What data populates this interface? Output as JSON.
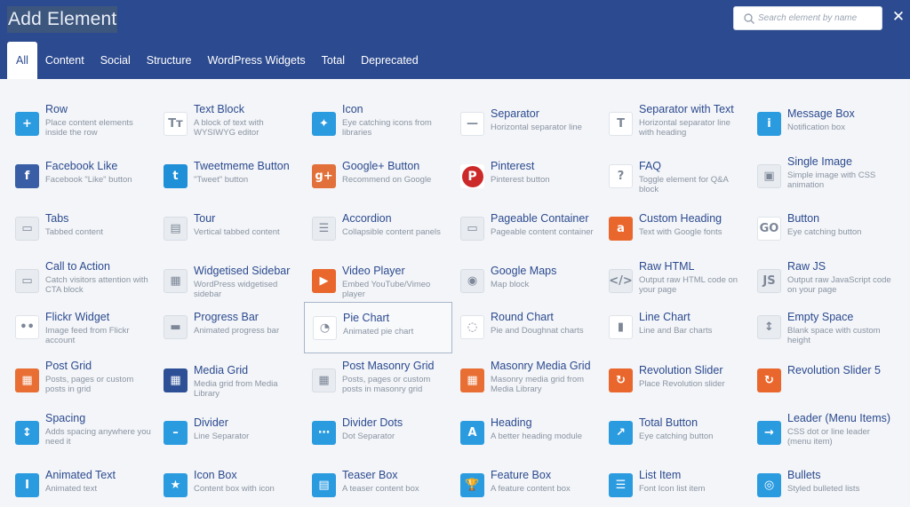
{
  "header": {
    "title": "Add Element",
    "search_placeholder": "Search element by name",
    "close_symbol": "✕"
  },
  "tabs": [
    "All",
    "Content",
    "Social",
    "Structure",
    "WordPress Widgets",
    "Total",
    "Deprecated"
  ],
  "colors": {
    "header": "#2c4a8f",
    "accent_blue": "#2b9be0",
    "accent_orange": "#e9672d"
  },
  "elements": [
    {
      "name": "Row",
      "desc": "Place content elements inside the row",
      "icon": "plus-icon"
    },
    {
      "name": "Text Block",
      "desc": "A block of text with WYSIWYG editor",
      "icon": "text-icon"
    },
    {
      "name": "Icon",
      "desc": "Eye catching icons from libraries",
      "icon": "star-icon"
    },
    {
      "name": "Separator",
      "desc": "Horizontal separator line",
      "icon": "separator-icon"
    },
    {
      "name": "Separator with Text",
      "desc": "Horizontal separator line with heading",
      "icon": "separator-text-icon"
    },
    {
      "name": "Message Box",
      "desc": "Notification box",
      "icon": "info-icon"
    },
    {
      "name": "Facebook Like",
      "desc": "Facebook \"Like\" button",
      "icon": "facebook-icon"
    },
    {
      "name": "Tweetmeme Button",
      "desc": "\"Tweet\" button",
      "icon": "twitter-icon"
    },
    {
      "name": "Google+ Button",
      "desc": "Recommend on Google",
      "icon": "googleplus-icon"
    },
    {
      "name": "Pinterest",
      "desc": "Pinterest button",
      "icon": "pinterest-icon"
    },
    {
      "name": "FAQ",
      "desc": "Toggle element for Q&A block",
      "icon": "faq-icon"
    },
    {
      "name": "Single Image",
      "desc": "Simple image with CSS animation",
      "icon": "image-icon"
    },
    {
      "name": "Tabs",
      "desc": "Tabbed content",
      "icon": "tabs-icon"
    },
    {
      "name": "Tour",
      "desc": "Vertical tabbed content",
      "icon": "tour-icon"
    },
    {
      "name": "Accordion",
      "desc": "Collapsible content panels",
      "icon": "accordion-icon"
    },
    {
      "name": "Pageable Container",
      "desc": "Pageable content container",
      "icon": "pageable-icon"
    },
    {
      "name": "Custom Heading",
      "desc": "Text with Google fonts",
      "icon": "custom-heading-icon"
    },
    {
      "name": "Button",
      "desc": "Eye catching button",
      "icon": "button-icon"
    },
    {
      "name": "Call to Action",
      "desc": "Catch visitors attention with CTA block",
      "icon": "cta-icon"
    },
    {
      "name": "Widgetised Sidebar",
      "desc": "WordPress widgetised sidebar",
      "icon": "sidebar-icon"
    },
    {
      "name": "Video Player",
      "desc": "Embed YouTube/Vimeo player",
      "icon": "video-icon"
    },
    {
      "name": "Google Maps",
      "desc": "Map block",
      "icon": "map-icon"
    },
    {
      "name": "Raw HTML",
      "desc": "Output raw HTML code on your page",
      "icon": "html-icon"
    },
    {
      "name": "Raw JS",
      "desc": "Output raw JavaScript code on your page",
      "icon": "js-icon"
    },
    {
      "name": "Flickr Widget",
      "desc": "Image feed from Flickr account",
      "icon": "flickr-icon"
    },
    {
      "name": "Progress Bar",
      "desc": "Animated progress bar",
      "icon": "progress-bar-icon"
    },
    {
      "name": "Pie Chart",
      "desc": "Animated pie chart",
      "icon": "pie-chart-icon"
    },
    {
      "name": "Round Chart",
      "desc": "Pie and Doughnat charts",
      "icon": "round-chart-icon"
    },
    {
      "name": "Line Chart",
      "desc": "Line and Bar charts",
      "icon": "line-chart-icon"
    },
    {
      "name": "Empty Space",
      "desc": "Blank space with custom height",
      "icon": "empty-space-icon"
    },
    {
      "name": "Post Grid",
      "desc": "Posts, pages or custom posts in grid",
      "icon": "post-grid-icon"
    },
    {
      "name": "Media Grid",
      "desc": "Media grid from Media Library",
      "icon": "media-grid-icon"
    },
    {
      "name": "Post Masonry Grid",
      "desc": "Posts, pages or custom posts in masonry grid",
      "icon": "masonry-grid-icon"
    },
    {
      "name": "Masonry Media Grid",
      "desc": "Masonry media grid from Media Library",
      "icon": "masonry-media-icon"
    },
    {
      "name": "Revolution Slider",
      "desc": "Place Revolution slider",
      "icon": "refresh-icon"
    },
    {
      "name": "Revolution Slider 5",
      "desc": "",
      "icon": "refresh-icon"
    },
    {
      "name": "Spacing",
      "desc": "Adds spacing anywhere you need it",
      "icon": "spacing-icon"
    },
    {
      "name": "Divider",
      "desc": "Line Separator",
      "icon": "minus-icon"
    },
    {
      "name": "Divider Dots",
      "desc": "Dot Separator",
      "icon": "dots-icon"
    },
    {
      "name": "Heading",
      "desc": "A better heading module",
      "icon": "heading-icon"
    },
    {
      "name": "Total Button",
      "desc": "Eye catching button",
      "icon": "external-link-icon"
    },
    {
      "name": "Leader (Menu Items)",
      "desc": "CSS dot or line leader (menu item)",
      "icon": "arrow-right-icon"
    },
    {
      "name": "Animated Text",
      "desc": "Animated text",
      "icon": "animated-text-icon"
    },
    {
      "name": "Icon Box",
      "desc": "Content box with icon",
      "icon": "star-icon"
    },
    {
      "name": "Teaser Box",
      "desc": "A teaser content box",
      "icon": "file-icon"
    },
    {
      "name": "Feature Box",
      "desc": "A feature content box",
      "icon": "trophy-icon"
    },
    {
      "name": "List Item",
      "desc": "Font Icon list item",
      "icon": "list-icon"
    },
    {
      "name": "Bullets",
      "desc": "Styled bulleted lists",
      "icon": "bullets-icon"
    }
  ]
}
